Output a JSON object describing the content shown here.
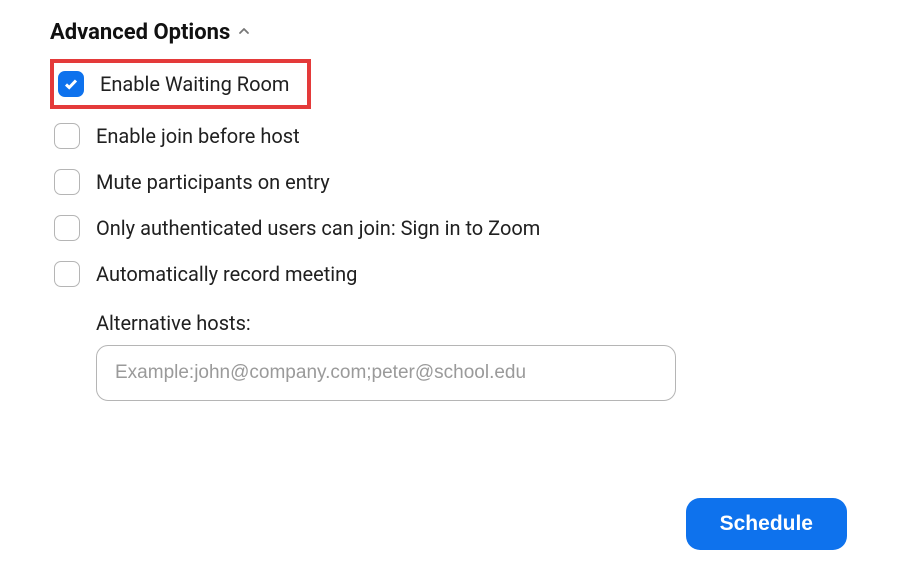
{
  "header": {
    "title": "Advanced Options"
  },
  "options": {
    "waiting_room": {
      "label": "Enable Waiting Room",
      "checked": true
    },
    "join_before_host": {
      "label": "Enable join before host",
      "checked": false
    },
    "mute_on_entry": {
      "label": "Mute participants on entry",
      "checked": false
    },
    "auth_users": {
      "label": "Only authenticated users can join: Sign in to Zoom",
      "checked": false
    },
    "auto_record": {
      "label": "Automatically record meeting",
      "checked": false
    }
  },
  "alt_hosts": {
    "label": "Alternative hosts:",
    "placeholder": "Example:john@company.com;peter@school.edu",
    "value": ""
  },
  "buttons": {
    "schedule": "Schedule"
  }
}
